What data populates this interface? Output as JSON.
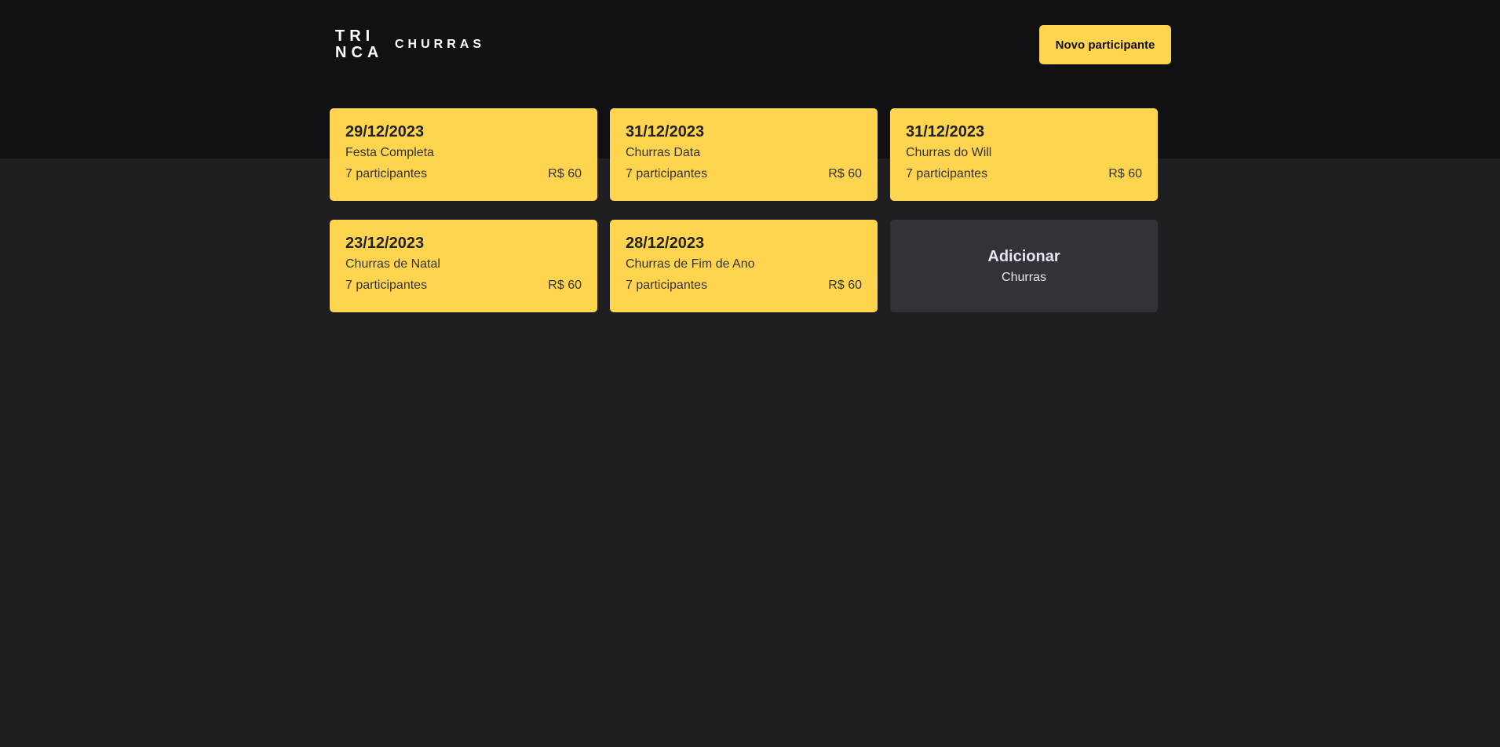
{
  "header": {
    "logo_line1": "TRI",
    "logo_line2": "NCA",
    "brand": "CHURRAS",
    "new_participant_label": "Novo participante"
  },
  "events": [
    {
      "date": "29/12/2023",
      "title": "Festa Completa",
      "participants": "7 participantes",
      "amount": "R$ 60"
    },
    {
      "date": "31/12/2023",
      "title": "Churras Data",
      "participants": "7 participantes",
      "amount": "R$ 60"
    },
    {
      "date": "31/12/2023",
      "title": "Churras do Will",
      "participants": "7 participantes",
      "amount": "R$ 60"
    },
    {
      "date": "23/12/2023",
      "title": "Churras de Natal",
      "participants": "7 participantes",
      "amount": "R$ 60"
    },
    {
      "date": "28/12/2023",
      "title": "Churras de Fim de Ano",
      "participants": "7 participantes",
      "amount": "R$ 60"
    }
  ],
  "add_card": {
    "title": "Adicionar",
    "subtitle": "Churras"
  },
  "colors": {
    "accent": "#ffd54f",
    "header_bg": "#111113",
    "page_bg": "#1f1f23",
    "add_card_bg": "#323238"
  }
}
